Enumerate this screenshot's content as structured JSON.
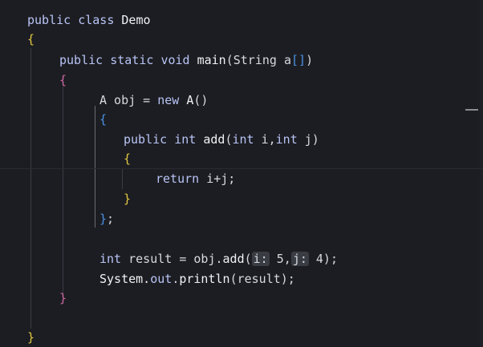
{
  "editor": {
    "lines": [
      {
        "id": "l1",
        "tokens": [
          {
            "t": "public ",
            "c": "kw"
          },
          {
            "t": "class ",
            "c": "kw"
          },
          {
            "t": "Demo",
            "c": "fn"
          }
        ]
      },
      {
        "id": "l2",
        "tokens": [
          {
            "t": "{",
            "c": "brace-yellow"
          }
        ]
      },
      {
        "id": "l3",
        "tokens": [
          {
            "t": "public ",
            "c": "kw"
          },
          {
            "t": "static ",
            "c": "kw"
          },
          {
            "t": "void ",
            "c": "kw"
          },
          {
            "t": "main",
            "c": "fn"
          },
          {
            "t": "(String a",
            "c": "punc"
          },
          {
            "t": "[]",
            "c": "brace-blue"
          },
          {
            "t": ")",
            "c": "punc"
          }
        ]
      },
      {
        "id": "l4",
        "tokens": [
          {
            "t": "{",
            "c": "brace-pink"
          }
        ]
      },
      {
        "id": "l5",
        "tokens": [
          {
            "t": "A obj = ",
            "c": "punc"
          },
          {
            "t": "new ",
            "c": "kw"
          },
          {
            "t": "A",
            "c": "fn"
          },
          {
            "t": "()",
            "c": "punc"
          }
        ]
      },
      {
        "id": "l6",
        "tokens": [
          {
            "t": "{",
            "c": "brace-blue"
          }
        ]
      },
      {
        "id": "l7",
        "tokens": [
          {
            "t": "public ",
            "c": "kw"
          },
          {
            "t": "int ",
            "c": "kw"
          },
          {
            "t": "add",
            "c": "fn"
          },
          {
            "t": "(",
            "c": "punc"
          },
          {
            "t": "int ",
            "c": "kw"
          },
          {
            "t": "i,",
            "c": "punc"
          },
          {
            "t": "int ",
            "c": "kw"
          },
          {
            "t": "j)",
            "c": "punc"
          }
        ]
      },
      {
        "id": "l8",
        "tokens": [
          {
            "t": "{",
            "c": "brace-yellow"
          }
        ]
      },
      {
        "id": "l9",
        "tokens": [
          {
            "t": "return ",
            "c": "kw"
          },
          {
            "t": "i+j;",
            "c": "punc"
          }
        ]
      },
      {
        "id": "l10",
        "tokens": [
          {
            "t": "}",
            "c": "brace-yellow"
          }
        ]
      },
      {
        "id": "l11",
        "tokens": [
          {
            "t": "}",
            "c": "brace-blue"
          },
          {
            "t": ";",
            "c": "punc"
          }
        ]
      },
      {
        "id": "l12",
        "tokens": [
          {
            "t": "int ",
            "c": "kw"
          },
          {
            "t": "result = obj.",
            "c": "punc"
          },
          {
            "t": "add",
            "c": "fn"
          },
          {
            "t": "(",
            "c": "punc"
          },
          {
            "t": "i:",
            "c": "hint"
          },
          {
            "t": " 5,",
            "c": "punc"
          },
          {
            "t": "j:",
            "c": "hint"
          },
          {
            "t": " 4);",
            "c": "punc"
          }
        ]
      },
      {
        "id": "l13",
        "tokens": [
          {
            "t": "System.",
            "c": "fn"
          },
          {
            "t": "out",
            "c": "kw"
          },
          {
            "t": ".",
            "c": "punc"
          },
          {
            "t": "println",
            "c": "fn"
          },
          {
            "t": "(result);",
            "c": "punc"
          }
        ]
      },
      {
        "id": "l14",
        "tokens": [
          {
            "t": "}",
            "c": "brace-pink"
          }
        ]
      },
      {
        "id": "l15",
        "tokens": [
          {
            "t": "}",
            "c": "brace-yellow"
          }
        ]
      }
    ]
  }
}
